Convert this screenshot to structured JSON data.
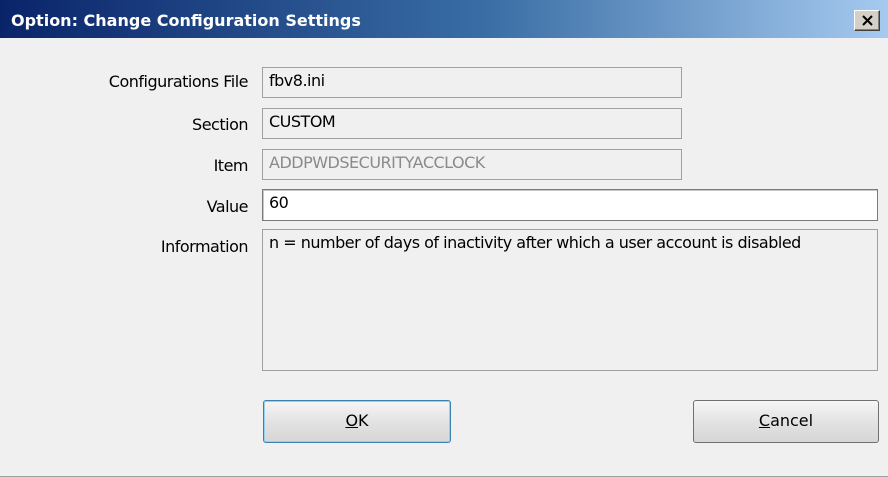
{
  "window": {
    "title": "Option: Change Configuration Settings",
    "close_glyph": "X"
  },
  "form": {
    "config_file": {
      "label": "Configurations File",
      "value": "fbv8.ini"
    },
    "section": {
      "label": "Section",
      "value": "CUSTOM"
    },
    "item": {
      "label": "Item",
      "value": "ADDPWDSECURITYACCLOCK"
    },
    "value": {
      "label": "Value",
      "value": "60"
    },
    "information": {
      "label": "Information",
      "value": "n = number of days of inactivity after which a user account is disabled"
    }
  },
  "buttons": {
    "ok": {
      "label_mnemonic": "O",
      "label_rest": "K"
    },
    "cancel": {
      "label_mnemonic": "C",
      "label_rest": "ancel"
    }
  },
  "colors": {
    "title_gradient_start": "#0a246a",
    "title_gradient_end": "#a6caf0",
    "dialog_bg": "#f0f0f0"
  }
}
